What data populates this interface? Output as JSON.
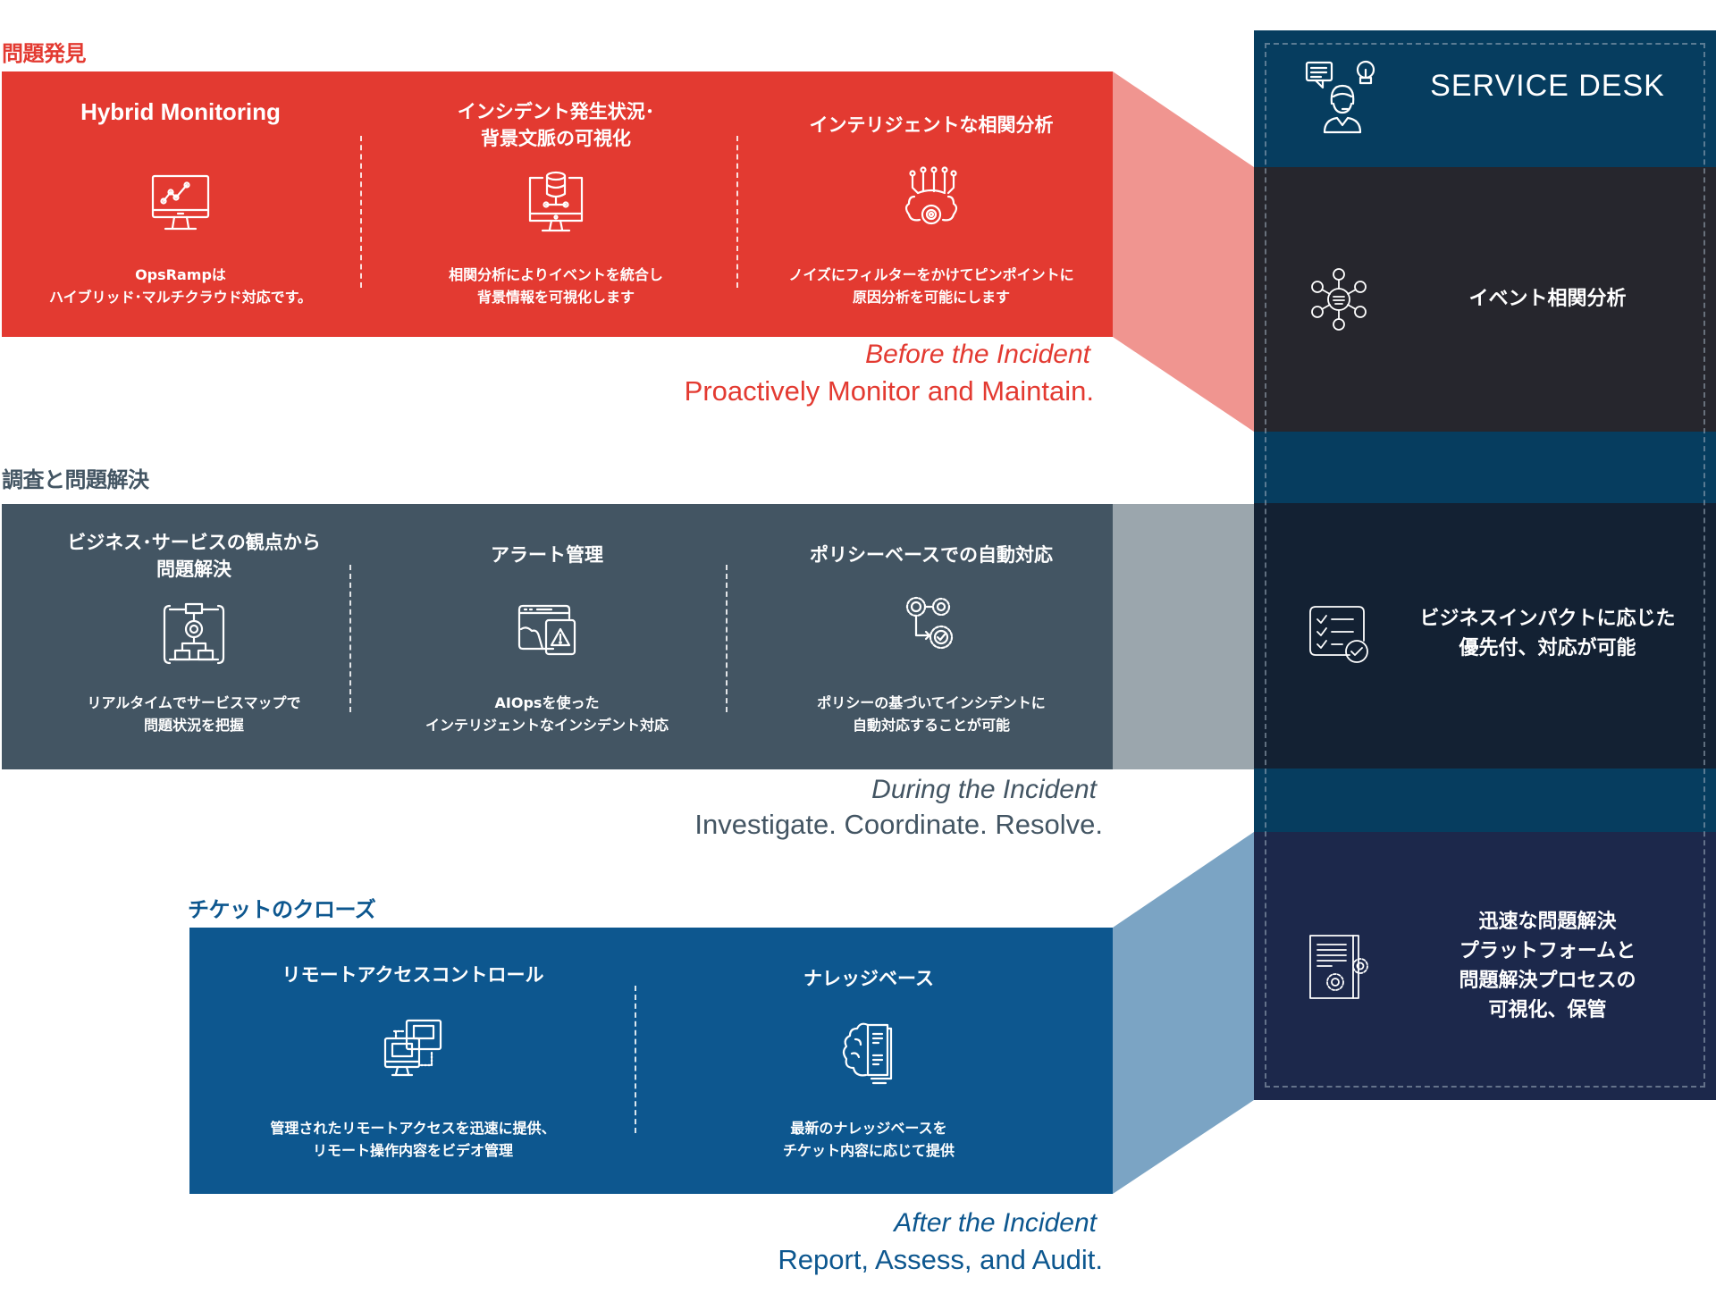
{
  "colors": {
    "red": "#e33a31",
    "red_light": "#f09590",
    "slate": "#435563",
    "slate_light": "#9ba6ad",
    "blue": "#0d578f",
    "blue_light": "#7ba4c4",
    "sd_header": "#063d5f",
    "sd_row1": "#26262d",
    "sd_row2": "#132133",
    "sd_row3": "#1c284b"
  },
  "sections": [
    {
      "label": "問題発見",
      "columns": [
        {
          "title": "Hybrid Monitoring",
          "icon": "monitor-chart-icon",
          "desc_lines": [
            "OpsRampは",
            "ハイブリッド･マルチクラウド対応です。"
          ]
        },
        {
          "title_lines": [
            "インシデント発生状況･",
            "背景文脈の可視化"
          ],
          "icon": "monitor-database-icon",
          "desc_lines": [
            "相関分析によりイベントを統合し",
            "背景情報を可視化します"
          ]
        },
        {
          "title": "インテリジェントな相関分析",
          "icon": "brain-gear-circuit-icon",
          "desc_lines": [
            "ノイズにフィルターをかけてピンポイントに",
            "原因分析を可能にします"
          ]
        }
      ],
      "tagline_italic": "Before the Incident",
      "tagline_bold": "Proactively Monitor and Maintain."
    },
    {
      "label": "調査と問題解決",
      "columns": [
        {
          "title_lines": [
            "ビジネス･サービスの観点から",
            "問題解決"
          ],
          "icon": "service-map-icon",
          "desc_lines": [
            "リアルタイムでサービスマップで",
            "問題状況を把握"
          ]
        },
        {
          "title": "アラート管理",
          "icon": "alert-window-icon",
          "desc_lines": [
            "AIOpsを使った",
            "インテリジェントなインシデント対応"
          ]
        },
        {
          "title": "ポリシーベースでの自動対応",
          "icon": "gears-automation-icon",
          "desc_lines": [
            "ポリシーの基づいてインシデントに",
            "自動対応することが可能"
          ]
        }
      ],
      "tagline_italic": "During the Incident",
      "tagline_bold": "Investigate. Coordinate. Resolve."
    },
    {
      "label": "チケットのクローズ",
      "columns": [
        {
          "title": "リモートアクセスコントロール",
          "icon": "remote-monitors-icon",
          "desc_lines": [
            "管理されたリモートアクセスを迅速に提供、",
            "リモート操作内容をビデオ管理"
          ]
        },
        {
          "title": "ナレッジベース",
          "icon": "brain-book-icon",
          "desc_lines": [
            "最新のナレッジベースを",
            "チケット内容に応じて提供"
          ]
        }
      ],
      "tagline_italic": "After the Incident",
      "tagline_bold": "Report, Assess, and Audit."
    }
  ],
  "service_desk": {
    "title": "SERVICE DESK",
    "icon": "support-agent-icon",
    "rows": [
      {
        "icon": "event-network-icon",
        "lines": [
          "イベント相関分析"
        ]
      },
      {
        "icon": "checklist-icon",
        "lines": [
          "ビジネスインパクトに応じた",
          "優先付、対応が可能"
        ]
      },
      {
        "icon": "document-gears-icon",
        "lines": [
          "迅速な問題解決",
          "プラットフォームと",
          "問題解決プロセスの",
          "可視化、保管"
        ]
      }
    ]
  }
}
